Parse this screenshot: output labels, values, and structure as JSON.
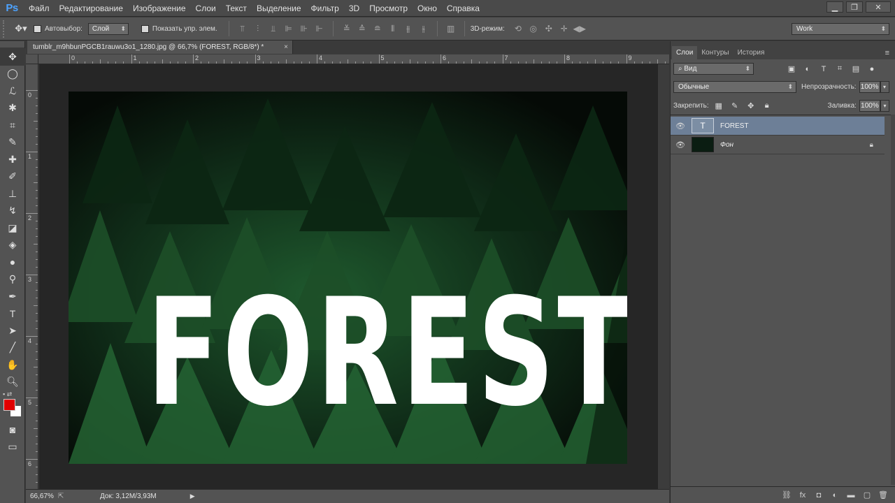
{
  "app": {
    "logo": "Ps"
  },
  "menu": [
    "Файл",
    "Редактирование",
    "Изображение",
    "Слои",
    "Текст",
    "Выделение",
    "Фильтр",
    "3D",
    "Просмотр",
    "Окно",
    "Справка"
  ],
  "window_controls": {
    "minimize": "▁",
    "restore": "❐",
    "close": "✕"
  },
  "options_bar": {
    "tool_icon": "move-icon",
    "autoselect_label": "Автовыбор:",
    "autoselect_value": "Слой",
    "show_controls_label": "Показать упр. элем.",
    "mode3d_label": "3D-режим:",
    "workspace": "Work"
  },
  "document": {
    "tab_title": "tumblr_m9hbunPGCB1rauwu3o1_1280.jpg @ 66,7% (FOREST, RGB/8*) *",
    "tab_close": "×",
    "canvas_text": "FOREST",
    "ruler_top_labels": [
      "0",
      "1",
      "2",
      "3",
      "4",
      "5",
      "6",
      "7",
      "8",
      "9"
    ],
    "ruler_left_labels": [
      "0",
      "1",
      "2",
      "3",
      "4",
      "5",
      "6"
    ]
  },
  "status": {
    "zoom": "66,67%",
    "doc_size": "Док: 3,12M/3,93M"
  },
  "colors": {
    "foreground": "#e00000",
    "background": "#ffffff",
    "selected_layer": "#6d7f97",
    "canvas_dark": "#08120b"
  },
  "layers_panel": {
    "tabs": [
      "Слои",
      "Контуры",
      "История"
    ],
    "filter_value": "Вид",
    "blend_mode": "Обычные",
    "opacity_label": "Непрозрачность:",
    "opacity_value": "100%",
    "lock_label": "Закрепить:",
    "fill_label": "Заливка:",
    "fill_value": "100%",
    "layers": [
      {
        "name": "FOREST",
        "type": "text",
        "selected": true
      },
      {
        "name": "Фон",
        "type": "background",
        "locked": true
      }
    ]
  }
}
